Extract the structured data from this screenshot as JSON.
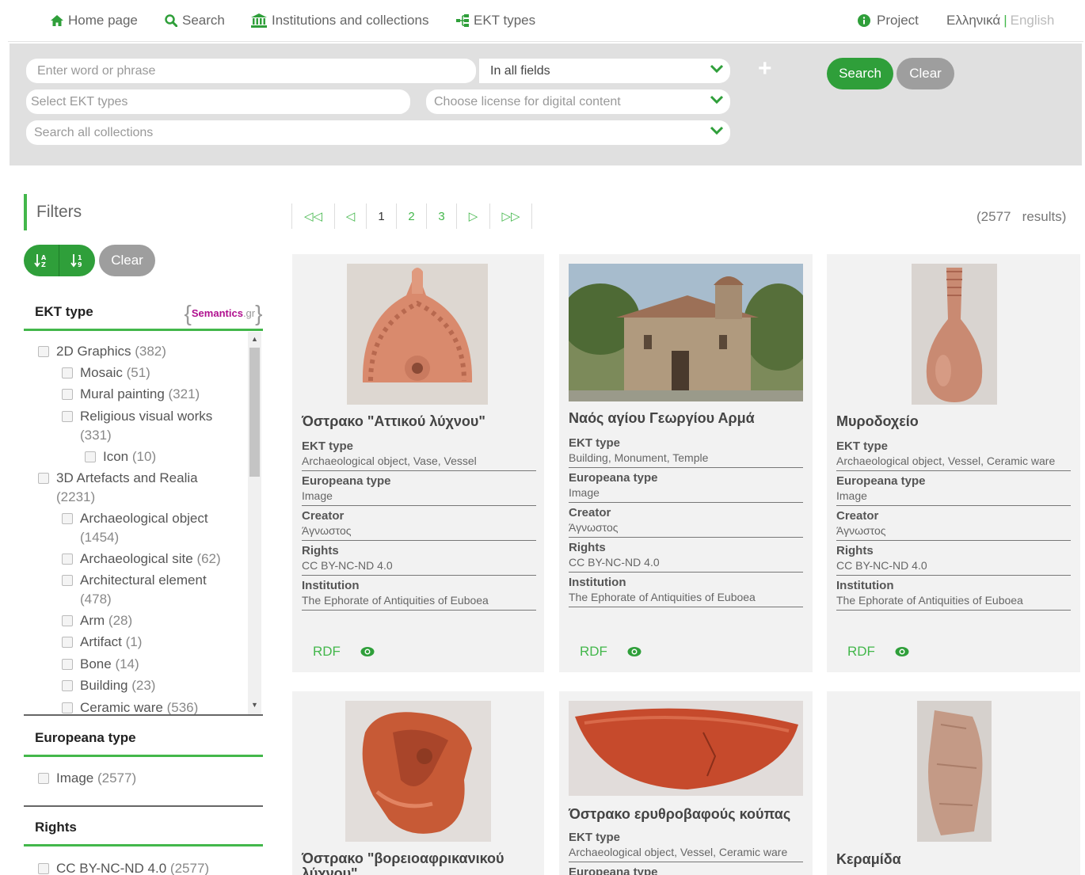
{
  "nav": {
    "home": "Home page",
    "search": "Search",
    "institutions": "Institutions and collections",
    "ekt_types": "EKT types",
    "project": "Project",
    "lang_el": "Ελληνικά",
    "lang_sep": "|",
    "lang_en": "English"
  },
  "search_form": {
    "query_placeholder": "Enter word or phrase",
    "field_select": "In all fields",
    "ekt_types_placeholder": "Select EKT types",
    "license_placeholder": "Choose license for digital content",
    "collections_placeholder": "Search all collections",
    "add": "+",
    "search_btn": "Search",
    "clear_btn": "Clear"
  },
  "colors": {
    "accent": "#43b74b",
    "accent_dark": "#2f9f3a",
    "muted_button": "#9e9e9e"
  },
  "filters": {
    "title": "Filters",
    "clear_btn": "Clear",
    "sort_az": "↓A",
    "sort_num": "↓9",
    "ekt_type": {
      "heading": "EKT type",
      "logo_main": "Semantics",
      "logo_suffix": ".gr",
      "items": [
        {
          "label": "2D Graphics",
          "count": "(382)"
        },
        {
          "label": "Mosaic",
          "count": "(51)"
        },
        {
          "label": "Mural painting",
          "count": "(321)"
        },
        {
          "label": "Religious visual works",
          "count": "(331)"
        },
        {
          "label": "Icon",
          "count": "(10)"
        },
        {
          "label": "3D Artefacts and Realia",
          "count": "(2231)"
        },
        {
          "label": "Archaeological object",
          "count": "(1454)"
        },
        {
          "label": "Archaeological site",
          "count": "(62)"
        },
        {
          "label": "Architectural element",
          "count": "(478)"
        },
        {
          "label": "Arm",
          "count": "(28)"
        },
        {
          "label": "Artifact",
          "count": "(1)"
        },
        {
          "label": "Bone",
          "count": "(14)"
        },
        {
          "label": "Building",
          "count": "(23)"
        },
        {
          "label": "Ceramic ware",
          "count": "(536)"
        }
      ]
    },
    "europeana_type": {
      "heading": "Europeana type",
      "items": [
        {
          "label": "Image",
          "count": "(2577)"
        }
      ]
    },
    "rights": {
      "heading": "Rights",
      "items": [
        {
          "label": "CC BY-NC-ND 4.0",
          "count": "(2577)"
        }
      ]
    }
  },
  "pagination": {
    "first": "◁◁",
    "prev": "◁",
    "pages": [
      "1",
      "2",
      "3"
    ],
    "current": "1",
    "next": "▷",
    "last": "▷▷",
    "results_count": "(2577",
    "results_word": "results)"
  },
  "labels": {
    "ekt_type": "EKT type",
    "europeana_type": "Europeana type",
    "creator": "Creator",
    "rights": "Rights",
    "institution": "Institution",
    "rdf": "RDF"
  },
  "cards": [
    {
      "title": "Όστρακο \"Αττικού λύχνου\"",
      "ekt_type": "Archaeological object, Vase, Vessel",
      "europeana_type": "Image",
      "creator": "Άγνωστος",
      "rights": "CC BY-NC-ND 4.0",
      "institution": "The Ephorate of Antiquities of Euboea",
      "thumb_icon": "lamp-fragment-photo"
    },
    {
      "title": "Ναός αγίου Γεωργίου Αρμά",
      "ekt_type": "Building, Monument, Temple",
      "europeana_type": "Image",
      "creator": "Άγνωστος",
      "rights": "CC BY-NC-ND 4.0",
      "institution": "The Ephorate of Antiquities of Euboea",
      "thumb_icon": "church-photo"
    },
    {
      "title": "Μυροδοχείο",
      "ekt_type": "Archaeological object, Vessel, Ceramic ware",
      "europeana_type": "Image",
      "creator": "Άγνωστος",
      "rights": "CC BY-NC-ND 4.0",
      "institution": "The Ephorate of Antiquities of Euboea",
      "thumb_icon": "vessel-photo"
    },
    {
      "title_line1": "Όστρακο \"βορειοαφρικανικού",
      "title_line2": "λύχνου\"",
      "thumb_icon": "lamp-fragment-photo"
    },
    {
      "title": "Όστρακο ερυθροβαφούς κούπας",
      "ekt_type": "Archaeological object, Vessel, Ceramic ware",
      "europeana_type_heading_only": true,
      "thumb_icon": "cup-fragment-photo"
    },
    {
      "title": "Κεραμίδα",
      "thumb_icon": "tile-photo"
    }
  ]
}
